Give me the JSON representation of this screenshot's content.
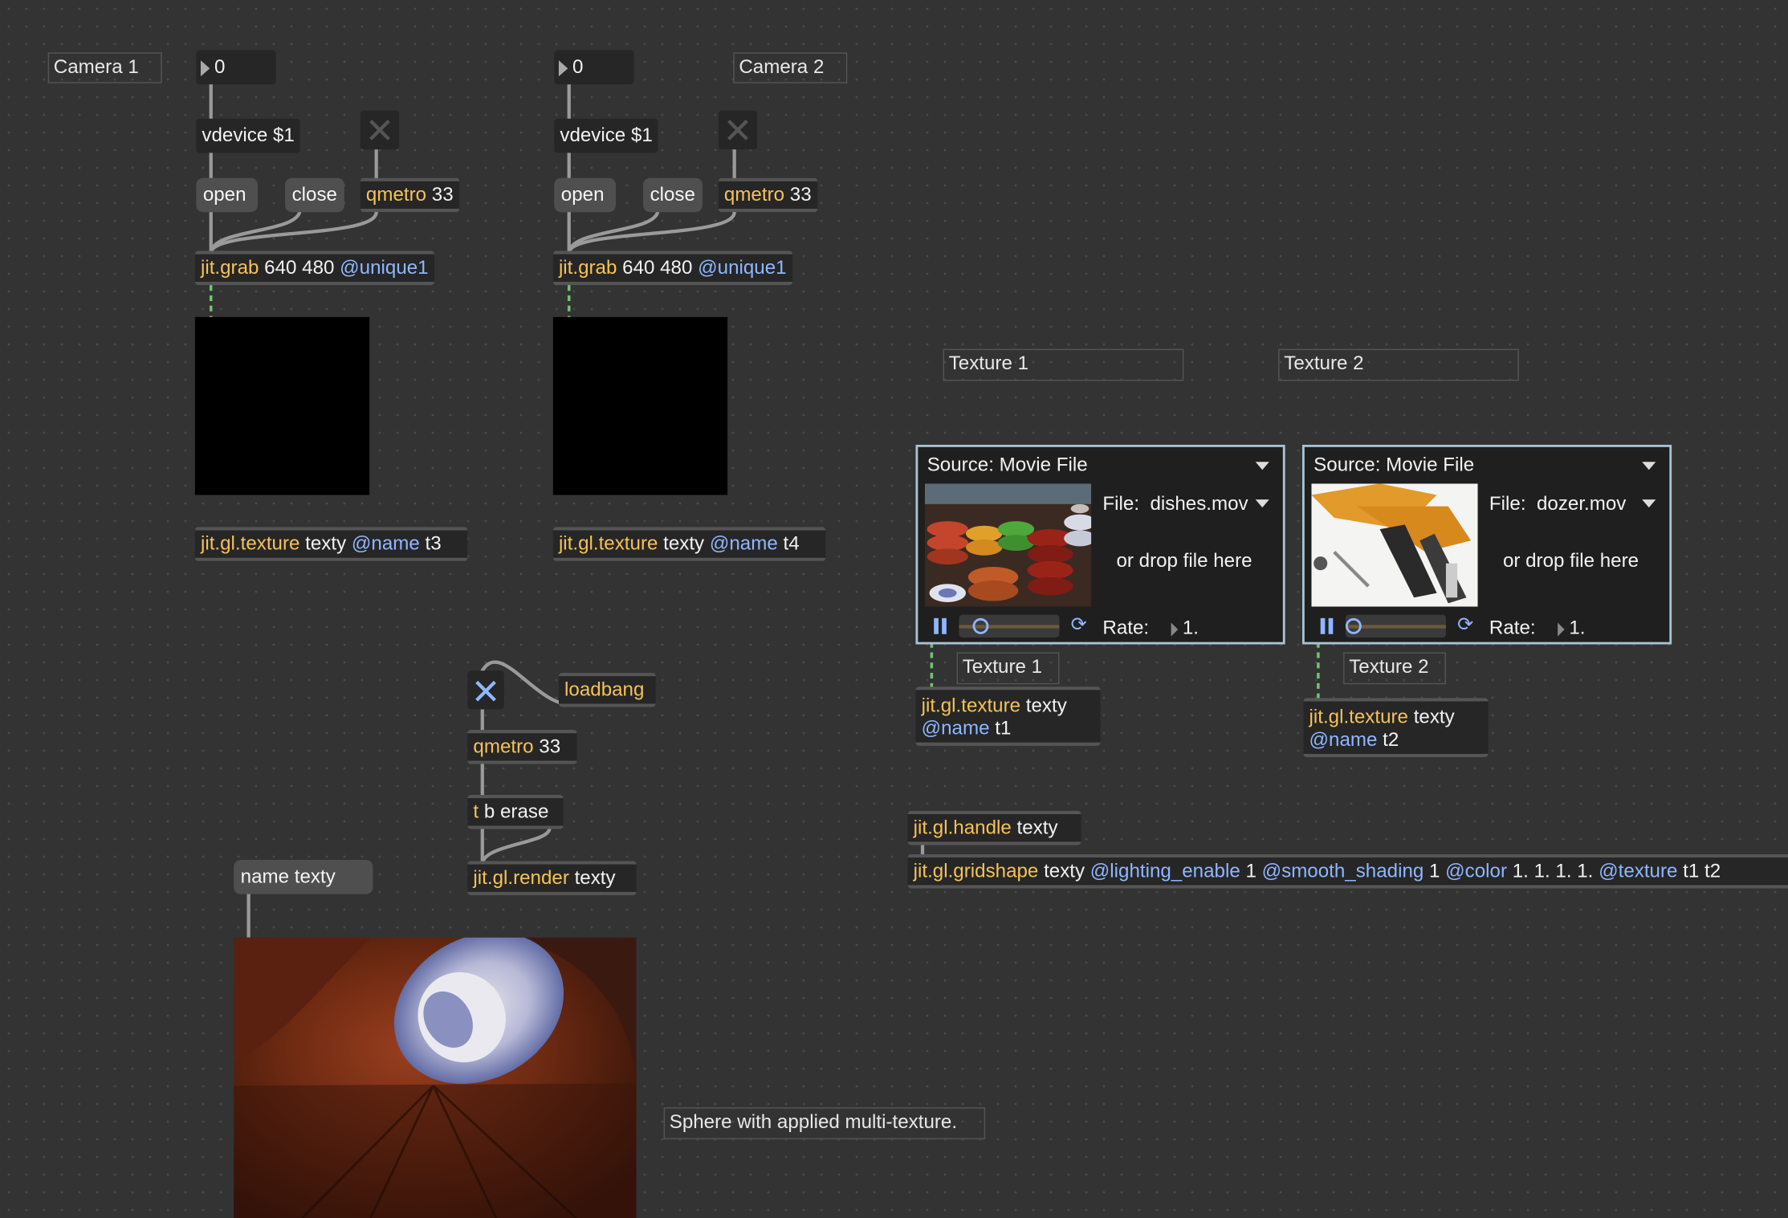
{
  "comments": {
    "camera1": "Camera 1",
    "camera2": "Camera 2",
    "texture1_header": "Texture 1",
    "texture2_header": "Texture 2",
    "texture1_label": "Texture 1",
    "texture2_label": "Texture 2",
    "sphere_caption": "Sphere with applied multi-texture."
  },
  "left_cam": {
    "number": "0",
    "vdevice": "vdevice $1",
    "open": "open",
    "close": "close",
    "qmetro_class": "qmetro",
    "qmetro_arg": " 33",
    "grab_class": "jit.grab",
    "grab_args": " 640 480 ",
    "grab_attr": "@unique1",
    "tex_class": "jit.gl.texture",
    "tex_args": " texty ",
    "tex_attr": "@name",
    "tex_val": " t3"
  },
  "right_cam": {
    "number": "0",
    "vdevice": "vdevice $1",
    "open": "open",
    "close": "close",
    "qmetro_class": "qmetro",
    "qmetro_arg": " 33",
    "grab_class": "jit.grab",
    "grab_args": " 640 480 ",
    "grab_attr": "@unique1",
    "tex_class": "jit.gl.texture",
    "tex_args": " texty ",
    "tex_attr": "@name",
    "tex_val": " t4"
  },
  "render_chain": {
    "loadbang": "loadbang",
    "qmetro_class": "qmetro",
    "qmetro_arg": " 33",
    "trigger_t": "t",
    "trigger_args": " b erase",
    "render_class": "jit.gl.render",
    "render_args": " texty",
    "name_msg": "name texty"
  },
  "player1": {
    "source": "Source: Movie File",
    "file_label": "File:",
    "file": "dishes.mov",
    "drop": "or drop file here",
    "rate_label": "Rate:",
    "rate": "1."
  },
  "player2": {
    "source": "Source: Movie File",
    "file_label": "File:",
    "file": "dozer.mov",
    "drop": "or drop file here",
    "rate_label": "Rate:",
    "rate": "1."
  },
  "tex1": {
    "class": "jit.gl.texture",
    "args": " texty",
    "attr": "@name",
    "val": " t1"
  },
  "tex2": {
    "class": "jit.gl.texture",
    "args": " texty",
    "attr": "@name",
    "val": " t2"
  },
  "handle": {
    "class": "jit.gl.handle",
    "args": " texty"
  },
  "gridshape": {
    "class": "jit.gl.gridshape",
    "args": " texty ",
    "a1": "@lighting_enable",
    "v1": " 1 ",
    "a2": "@smooth_shading",
    "v2": " 1 ",
    "a3": "@color",
    "v3": " 1. 1. 1. 1. ",
    "a4": "@texture",
    "v4": " t1 t2"
  },
  "colors": {
    "background": "#333333",
    "object_text_class": "#f6c257",
    "attribute": "#8fb7ff",
    "toggle_active": "#8fb7ff",
    "player_border": "#a8c4d6"
  }
}
